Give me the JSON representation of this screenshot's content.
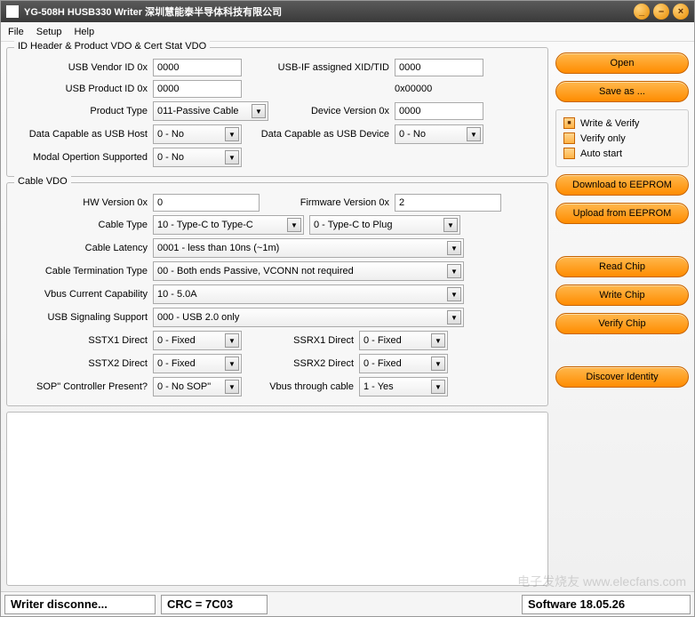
{
  "window": {
    "title": "YG-508H HUSB330 Writer  深圳慧能泰半导体科技有限公司"
  },
  "menu": {
    "file": "File",
    "setup": "Setup",
    "help": "Help"
  },
  "group1": {
    "legend": "ID Header & Product VDO & Cert Stat VDO",
    "vendor_lbl": "USB Vendor ID 0x",
    "vendor_val": "0000",
    "product_lbl": "USB Product ID 0x",
    "product_val": "0000",
    "ptype_lbl": "Product Type",
    "ptype_val": "011-Passive Cable",
    "host_lbl": "Data Capable as USB Host",
    "host_val": "0 - No",
    "modal_lbl": "Modal Opertion Supported",
    "modal_val": "0 - No",
    "xid_lbl": "USB-IF assigned XID/TID",
    "xid_val": "0000",
    "xid_hex": "0x00000",
    "devver_lbl": "Device Version 0x",
    "devver_val": "0000",
    "device_lbl": "Data Capable as USB Device",
    "device_val": "0 - No"
  },
  "group2": {
    "legend": "Cable VDO",
    "hw_lbl": "HW Version  0x",
    "hw_val": "0",
    "fw_lbl": "Firmware Version  0x",
    "fw_val": "2",
    "ctype_lbl": "Cable Type",
    "ctype_val": "10 - Type-C to Type-C",
    "ctype2_val": "0 - Type-C to Plug",
    "lat_lbl": "Cable Latency",
    "lat_val": "0001 - less than 10ns (~1m)",
    "term_lbl": "Cable Termination Type",
    "term_val": "00 - Both ends Passive, VCONN not required",
    "vbus_lbl": "Vbus Current Capability",
    "vbus_val": "10 - 5.0A",
    "sig_lbl": "USB Signaling Support",
    "sig_val": "000 - USB 2.0 only",
    "sstx1_lbl": "SSTX1 Direct",
    "sstx1_val": "0 - Fixed",
    "ssrx1_lbl": "SSRX1 Direct",
    "ssrx1_val": "0 - Fixed",
    "sstx2_lbl": "SSTX2 Direct",
    "sstx2_val": "0 - Fixed",
    "ssrx2_lbl": "SSRX2 Direct",
    "ssrx2_val": "0 - Fixed",
    "sop_lbl": "SOP\" Controller Present?",
    "sop_val": "0 - No SOP\"",
    "vbusthru_lbl": "Vbus through cable",
    "vbusthru_val": "1 - Yes"
  },
  "buttons": {
    "open": "Open",
    "saveas": "Save as ...",
    "download": "Download to EEPROM",
    "upload": "Upload from EEPROM",
    "read": "Read Chip",
    "write": "Write Chip",
    "verify": "Verify Chip",
    "discover": "Discover Identity"
  },
  "checks": {
    "wv": "Write & Verify",
    "vo": "Verify only",
    "auto": "Auto start"
  },
  "status": {
    "writer": "Writer disconne...",
    "crc": "CRC = 7C03",
    "sw": "Software    18.05.26"
  },
  "watermark": "电子发烧友 www.elecfans.com"
}
